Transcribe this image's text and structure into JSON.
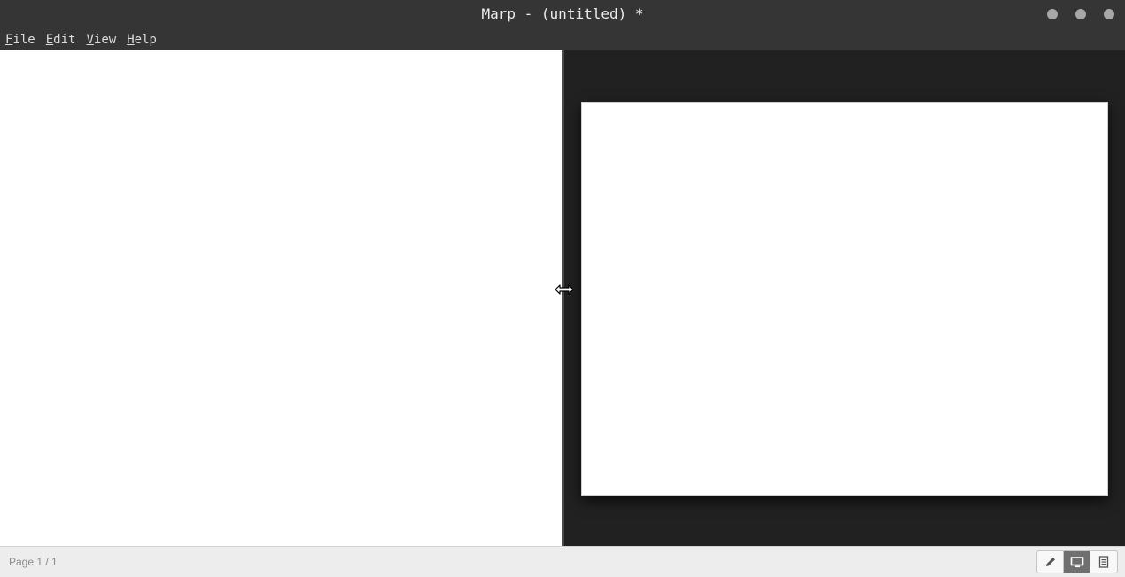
{
  "window": {
    "title": "Marp - (untitled) *",
    "controls": [
      "minimize-icon",
      "maximize-icon",
      "close-icon"
    ]
  },
  "menubar": {
    "items": [
      {
        "label": "File",
        "mnemonic": "F",
        "rest": "ile"
      },
      {
        "label": "Edit",
        "mnemonic": "E",
        "rest": "dit"
      },
      {
        "label": "View",
        "mnemonic": "V",
        "rest": "iew"
      },
      {
        "label": "Help",
        "mnemonic": "H",
        "rest": "elp"
      }
    ]
  },
  "editor": {
    "content": ""
  },
  "preview": {
    "background_color": "#212121",
    "slide_color": "#ffffff"
  },
  "statusbar": {
    "page_indicator": "Page 1 / 1",
    "view_modes": [
      {
        "name": "edit-mode",
        "icon": "pencil-icon",
        "active": false
      },
      {
        "name": "slide-mode",
        "icon": "monitor-icon",
        "active": true
      },
      {
        "name": "document-mode",
        "icon": "document-icon",
        "active": false
      }
    ]
  },
  "colors": {
    "titlebar": "#353535",
    "preview_bg": "#212121",
    "statusbar": "#ededed",
    "active_mode": "#6f6f6f"
  }
}
